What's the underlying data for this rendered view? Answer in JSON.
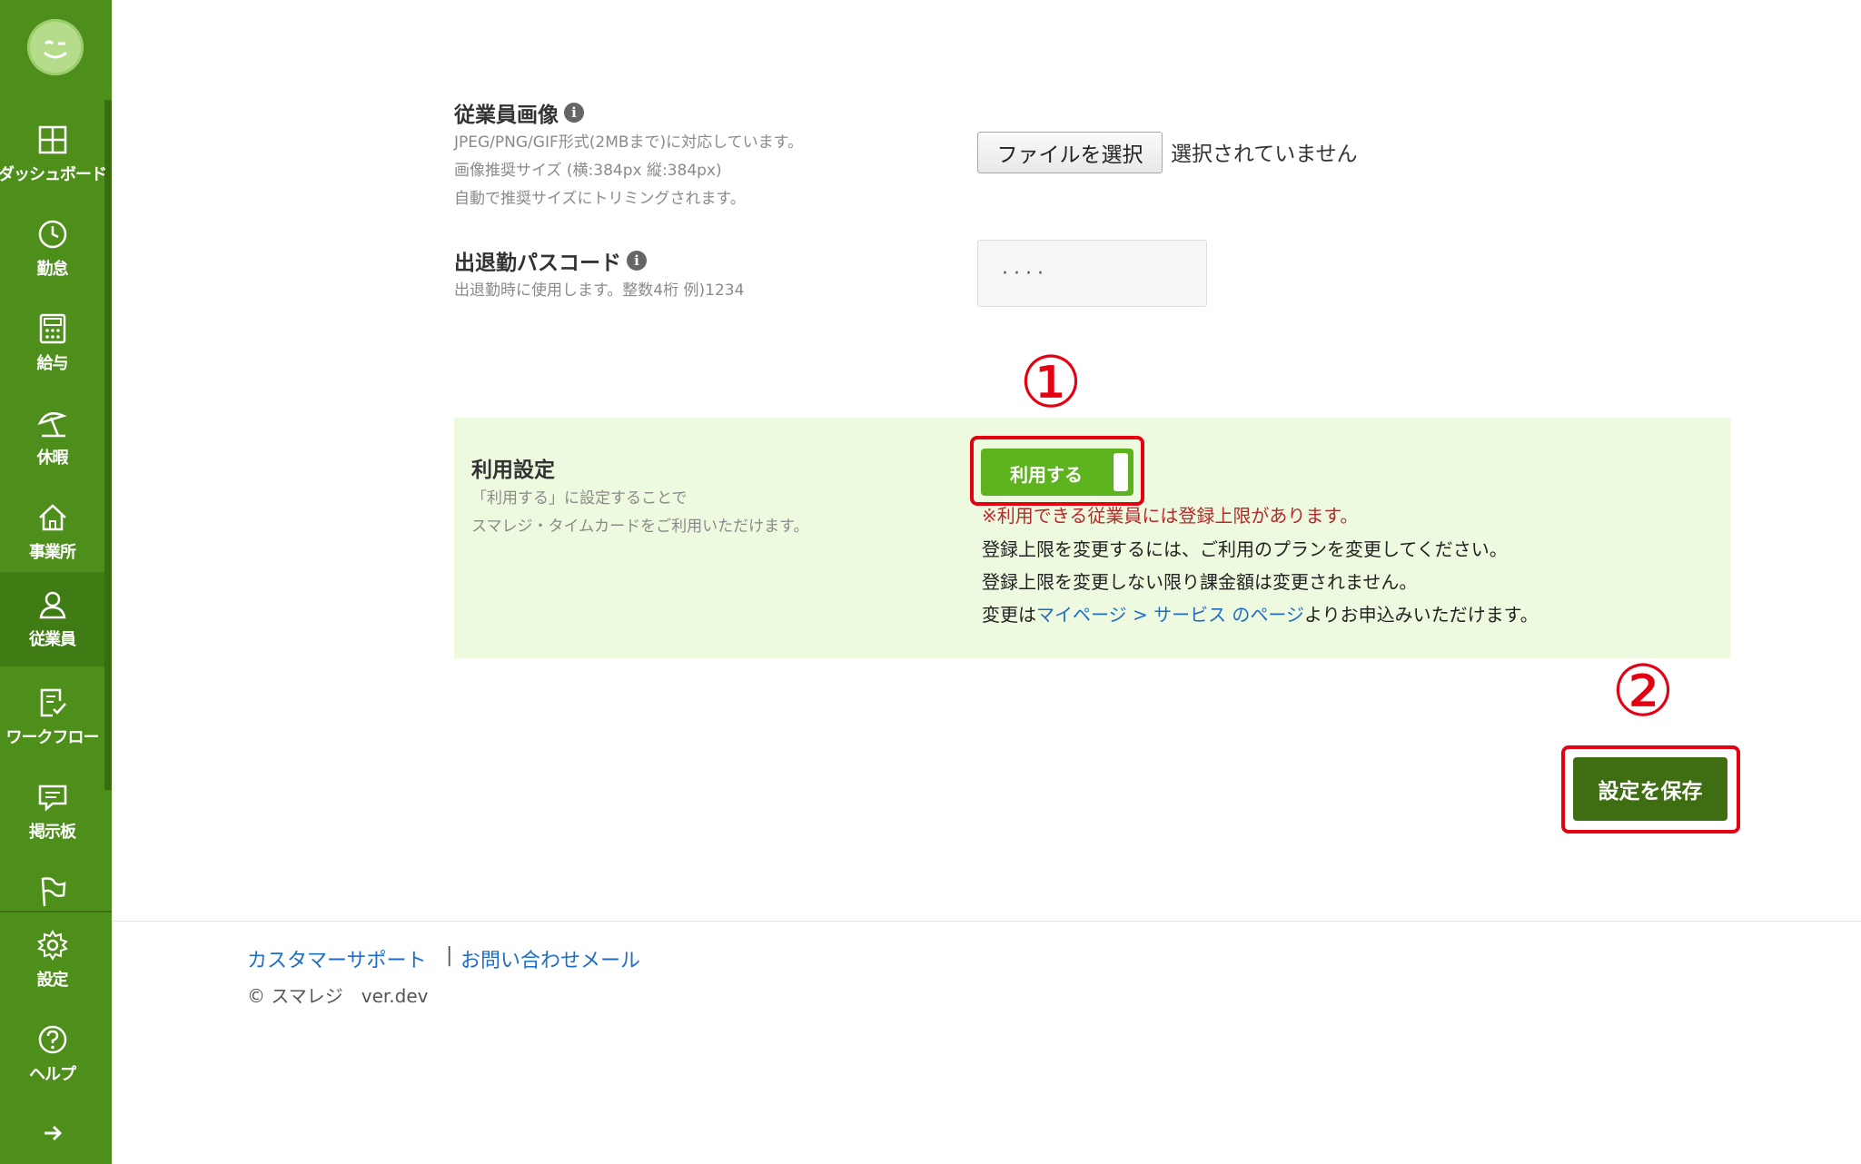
{
  "sidebar": {
    "items": [
      {
        "label": "ダッシュボード",
        "icon": "dashboard-icon"
      },
      {
        "label": "勤怠",
        "icon": "clock-icon"
      },
      {
        "label": "給与",
        "icon": "calculator-icon"
      },
      {
        "label": "休暇",
        "icon": "umbrella-icon"
      },
      {
        "label": "事業所",
        "icon": "home-icon"
      },
      {
        "label": "従業員",
        "icon": "person-icon"
      },
      {
        "label": "ワークフロー",
        "icon": "checklist-icon"
      },
      {
        "label": "掲示板",
        "icon": "chat-icon"
      }
    ],
    "settings_label": "設定",
    "help_label": "ヘルプ",
    "active_item": "従業員",
    "brand_color": "#4e8f1c"
  },
  "employee_image": {
    "title": "従業員画像",
    "hints": [
      "JPEG/PNG/GIF形式(2MBまで)に対応しています。",
      "画像推奨サイズ (横:384px 縦:384px)",
      "自動で推奨サイズにトリミングされます。"
    ],
    "file_button": "ファイルを選択",
    "file_status": "選択されていません"
  },
  "passcode": {
    "title": "出退勤パスコード",
    "hint": "出退勤時に使用します。整数4桁 例)1234",
    "value": "····"
  },
  "usage": {
    "title": "利用設定",
    "hints": [
      "「利用する」に設定することで",
      "スマレジ・タイムカードをご利用いただけます。"
    ],
    "toggle_label": "利用する",
    "toggle_on": true,
    "warning": "※利用できる従業員には登録上限があります。",
    "note1": "登録上限を変更するには、ご利用のプランを変更してください。",
    "note2": "登録上限を変更しない限り課金額は変更されません。",
    "note3_prefix": "変更は",
    "note3_link": "マイページ > サービス のページ",
    "note3_suffix": "よりお申込みいただけます。"
  },
  "annotations": {
    "one": "①",
    "two": "②",
    "color": "#e50012"
  },
  "save_button": "設定を保存",
  "footer": {
    "support_link": "カスタマーサポート",
    "separator": "|",
    "contact_link": "お問い合わせメール",
    "copyright": "© スマレジ　ver.dev"
  }
}
